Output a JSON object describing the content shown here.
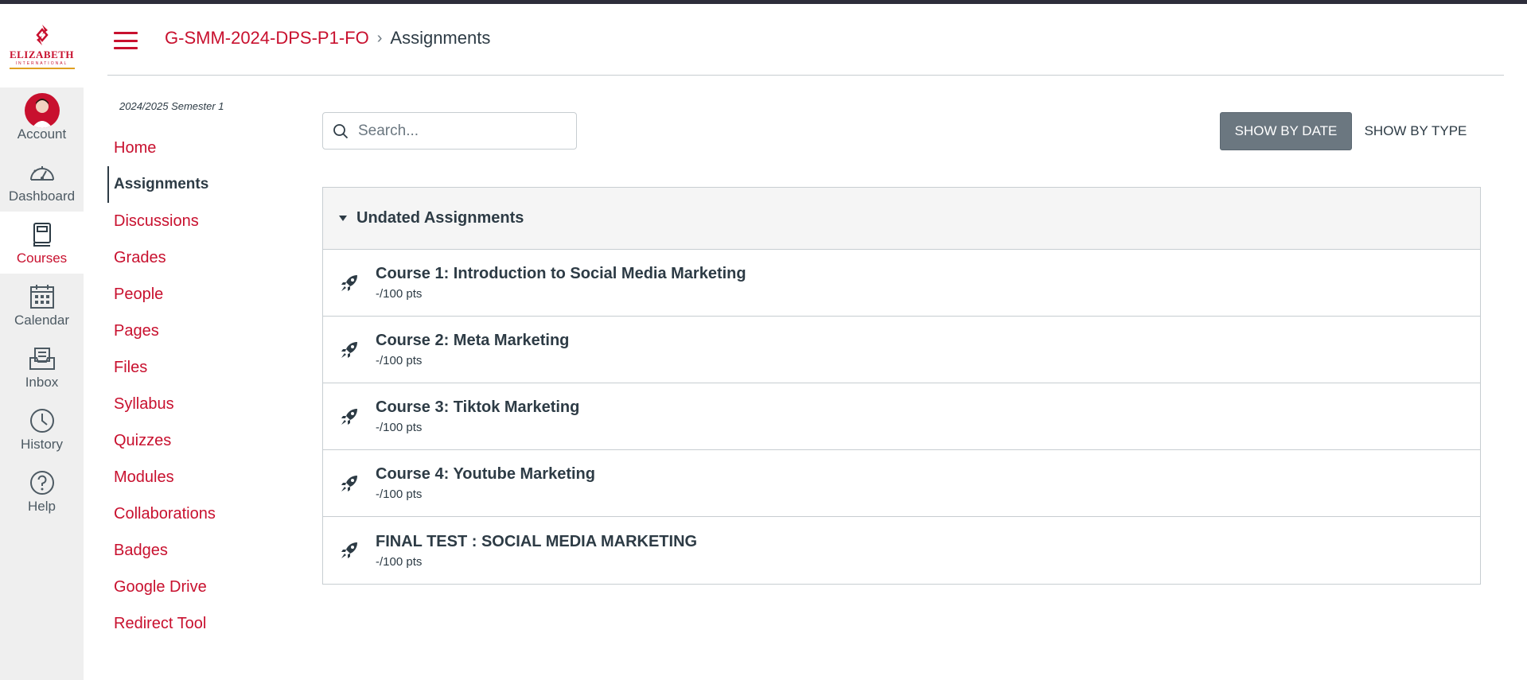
{
  "brand": {
    "logo_text": "ELIZABETH",
    "logo_sub": "INTERNATIONAL"
  },
  "global_nav": [
    {
      "label": "Account",
      "icon": "avatar"
    },
    {
      "label": "Dashboard",
      "icon": "dashboard-icon"
    },
    {
      "label": "Courses",
      "icon": "courses-icon",
      "active": true
    },
    {
      "label": "Calendar",
      "icon": "calendar-icon"
    },
    {
      "label": "Inbox",
      "icon": "inbox-icon"
    },
    {
      "label": "History",
      "icon": "history-icon"
    },
    {
      "label": "Help",
      "icon": "help-icon"
    }
  ],
  "breadcrumb": {
    "course": "G-SMM-2024-DPS-P1-FO",
    "separator": "›",
    "current": "Assignments"
  },
  "course_nav": {
    "term": "2024/2025 Semester 1",
    "items": [
      "Home",
      "Assignments",
      "Discussions",
      "Grades",
      "People",
      "Pages",
      "Files",
      "Syllabus",
      "Quizzes",
      "Modules",
      "Collaborations",
      "Badges",
      "Google Drive",
      "Redirect Tool"
    ],
    "active_index": 1
  },
  "toolbar": {
    "search_placeholder": "Search...",
    "show_by_date": "SHOW BY DATE",
    "show_by_type": "SHOW BY TYPE"
  },
  "assignment_group": {
    "title": "Undated Assignments",
    "items": [
      {
        "title": "Course 1: Introduction to Social Media Marketing",
        "points": "-/100 pts"
      },
      {
        "title": "Course 2: Meta Marketing",
        "points": "-/100 pts"
      },
      {
        "title": "Course 3: Tiktok Marketing",
        "points": "-/100 pts"
      },
      {
        "title": "Course 4: Youtube Marketing",
        "points": "-/100 pts"
      },
      {
        "title": "FINAL TEST : SOCIAL MEDIA MARKETING",
        "points": "-/100 pts"
      }
    ]
  },
  "colors": {
    "brand_red": "#c8102e",
    "text_dark": "#2d3b45",
    "button_gray": "#6b7780",
    "nav_bg": "#efefef"
  }
}
